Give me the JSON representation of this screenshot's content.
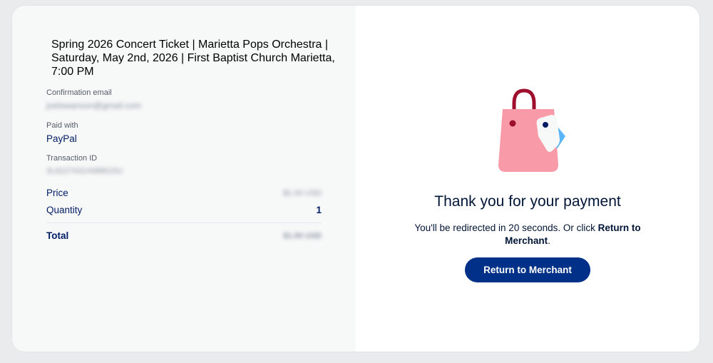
{
  "order": {
    "item_title": "Spring 2026 Concert Ticket | Marietta Pops Orchestra | Saturday, May 2nd, 2026 | First Baptist Church Marietta, 7:00 PM",
    "confirmation_email_label": "Confirmation email",
    "confirmation_email_value": "joelswanson@gmail.com",
    "paid_with_label": "Paid with",
    "paid_with_value": "PayPal",
    "transaction_id_label": "Transaction ID",
    "transaction_id_value": "3L6227431X688615U",
    "price_label": "Price",
    "price_value": "$1.00 USD",
    "quantity_label": "Quantity",
    "quantity_value": "1",
    "total_label": "Total",
    "total_value": "$1.00 USD"
  },
  "confirmation": {
    "bag_icon": "shopping-bag-with-tag-icon",
    "heading": "Thank you for your payment",
    "redirect_prefix": "You'll be redirected in 20 seconds. Or click ",
    "redirect_link": "Return to Merchant",
    "redirect_suffix": ".",
    "button_label": "Return to Merchant"
  },
  "colors": {
    "button": "#003087",
    "text_dark": "#001c64",
    "bag_pink": "#f99aa9",
    "bag_handle": "#9e0e2d",
    "tag_blue": "#5bb6f7"
  }
}
